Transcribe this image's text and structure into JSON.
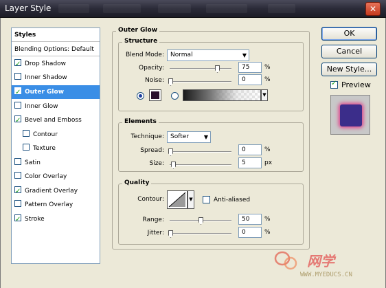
{
  "window": {
    "title": "Layer Style",
    "close_glyph": "✕"
  },
  "styles_list": {
    "header": "Styles",
    "blending_options": "Blending Options: Default",
    "items": [
      {
        "label": "Drop Shadow",
        "checked": true
      },
      {
        "label": "Inner Shadow",
        "checked": false
      },
      {
        "label": "Outer Glow",
        "checked": true,
        "selected": true
      },
      {
        "label": "Inner Glow",
        "checked": false
      },
      {
        "label": "Bevel and Emboss",
        "checked": true
      },
      {
        "label": "Contour",
        "checked": false,
        "indent": true
      },
      {
        "label": "Texture",
        "checked": false,
        "indent": true
      },
      {
        "label": "Satin",
        "checked": false
      },
      {
        "label": "Color Overlay",
        "checked": false
      },
      {
        "label": "Gradient Overlay",
        "checked": true
      },
      {
        "label": "Pattern Overlay",
        "checked": false
      },
      {
        "label": "Stroke",
        "checked": true
      }
    ]
  },
  "outer_glow": {
    "title": "Outer Glow",
    "structure": {
      "title": "Structure",
      "blend_mode_label": "Blend Mode:",
      "blend_mode_value": "Normal",
      "opacity_label": "Opacity:",
      "opacity_value": "75",
      "opacity_unit": "%",
      "noise_label": "Noise:",
      "noise_value": "0",
      "noise_unit": "%",
      "glow_color": "#2a0f2e"
    },
    "elements": {
      "title": "Elements",
      "technique_label": "Technique:",
      "technique_value": "Softer",
      "spread_label": "Spread:",
      "spread_value": "0",
      "spread_unit": "%",
      "size_label": "Size:",
      "size_value": "5",
      "size_unit": "px"
    },
    "quality": {
      "title": "Quality",
      "contour_label": "Contour:",
      "anti_aliased_label": "Anti-aliased",
      "anti_aliased_checked": false,
      "range_label": "Range:",
      "range_value": "50",
      "range_unit": "%",
      "jitter_label": "Jitter:",
      "jitter_value": "0",
      "jitter_unit": "%"
    }
  },
  "buttons": {
    "ok": "OK",
    "cancel": "Cancel",
    "new_style": "New Style...",
    "preview_label": "Preview",
    "preview_checked": true
  },
  "watermark": {
    "site": "WWW.MYEDUCS.CN"
  },
  "colors": {
    "selection": "#3a8ee6",
    "preview_inner": "#3b2d8a",
    "preview_glow": "#e0408a"
  }
}
